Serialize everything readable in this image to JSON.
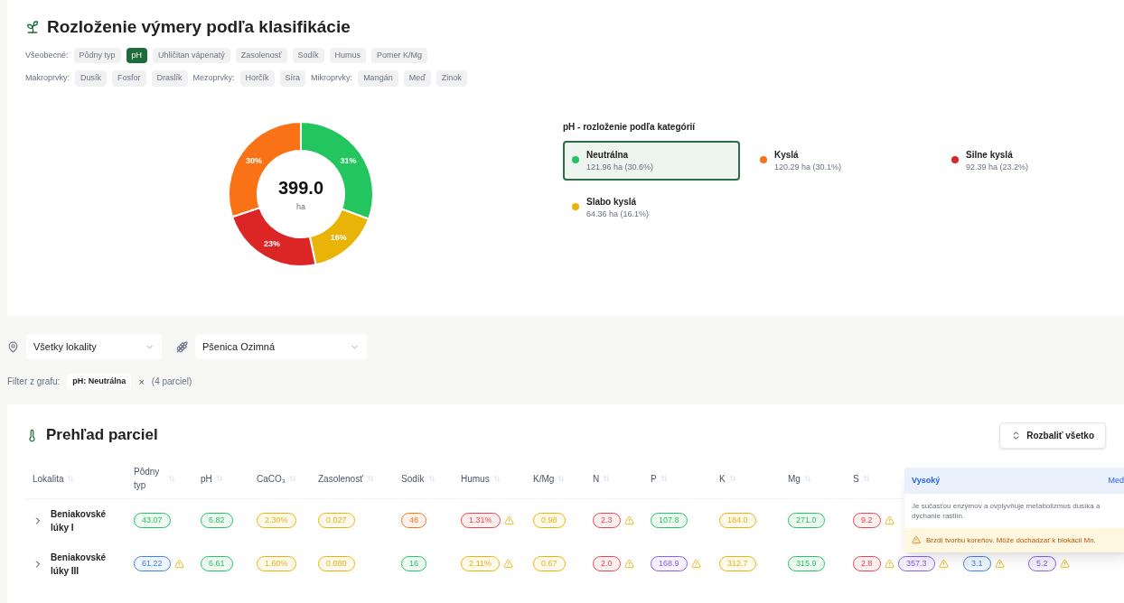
{
  "distribution": {
    "title": "Rozloženie výmery podľa klasifikácie",
    "filter_lines": [
      [
        {
          "label": "Všeobecné:",
          "chips": [
            {
              "label": "Pôdny typ",
              "selected": false
            },
            {
              "label": "pH",
              "selected": true
            },
            {
              "label": "Uhličitan vápenatý",
              "selected": false
            },
            {
              "label": "Zasolenosť",
              "selected": false
            },
            {
              "label": "Sodík",
              "selected": false
            },
            {
              "label": "Humus",
              "selected": false
            },
            {
              "label": "Pomer K/Mg",
              "selected": false
            }
          ]
        }
      ],
      [
        {
          "label": "Makroprvky:",
          "chips": [
            {
              "label": "Dusík",
              "selected": false
            },
            {
              "label": "Fosfor",
              "selected": false
            },
            {
              "label": "Draslík",
              "selected": false
            }
          ]
        },
        {
          "label": "Mezoprvky:",
          "chips": [
            {
              "label": "Horčík",
              "selected": false
            },
            {
              "label": "Síra",
              "selected": false
            }
          ]
        },
        {
          "label": "Mikroprvky:",
          "chips": [
            {
              "label": "Mangán",
              "selected": false
            },
            {
              "label": "Meď",
              "selected": false
            },
            {
              "label": "Zinok",
              "selected": false
            }
          ]
        }
      ]
    ],
    "donut_total": "399.0",
    "donut_unit": "ha",
    "chart_data": {
      "type": "donut",
      "series": [
        {
          "values": [
            30.6,
            16.1,
            23.2,
            30.1
          ]
        }
      ],
      "colors": [
        "#22c55e",
        "#eab308",
        "#dc2626",
        "#f97316"
      ],
      "value_labels": [
        "31%",
        "16%",
        "23%",
        "30%"
      ]
    },
    "legend_title": "pH - rozloženie podľa kategórií",
    "legend": [
      {
        "label": "Neutrálna",
        "detail": "121.96 ha (30.6%)",
        "color": "#22c55e",
        "selected": true
      },
      {
        "label": "Kyslá",
        "detail": "120.29 ha (30.1%)",
        "color": "#f97316",
        "selected": false
      },
      {
        "label": "Silne kyslá",
        "detail": "92.39 ha (23.2%)",
        "color": "#dc2626",
        "selected": false
      },
      {
        "label": "Slabo kyslá",
        "detail": "64.36 ha (16.1%)",
        "color": "#eab308",
        "selected": false
      }
    ]
  },
  "filters": {
    "location": "Všetky lokality",
    "crop": "Pšenica Ozimná",
    "chart_filter_label": "Filter z grafu:",
    "chart_filter_chip": "pH: Neutrálna",
    "chart_filter_remove": "×",
    "chart_filter_count": "(4 parciel)"
  },
  "parcels": {
    "title": "Prehľad parciel",
    "expand_button": "Rozbaliť všetko",
    "columns": [
      "Lokalita",
      "Pôdny typ",
      "pH",
      "CaCO₃",
      "Zasolenosť",
      "Sodík",
      "Humus",
      "K/Mg",
      "N",
      "P",
      "K",
      "Mg",
      "S"
    ],
    "rows": [
      {
        "cells": [
          {
            "kind": "location",
            "value": "Beniakovské lúky I"
          },
          {
            "kind": "badge",
            "value": "43.07",
            "color": "#22c55e"
          },
          {
            "kind": "badge",
            "value": "6.82",
            "color": "#22c55e"
          },
          {
            "kind": "badge",
            "value": "2.30%",
            "color": "#eab308"
          },
          {
            "kind": "badge",
            "value": "0.027",
            "color": "#eab308"
          },
          {
            "kind": "badge",
            "value": "48",
            "color": "#f97316"
          },
          {
            "kind": "flagged",
            "value": "1.31%",
            "color": "#ef4444"
          },
          {
            "kind": "badge",
            "value": "0.98",
            "color": "#eab308"
          },
          {
            "kind": "flagged",
            "value": "2.3",
            "color": "#ef4444"
          },
          {
            "kind": "badge",
            "value": "107.8",
            "color": "#22c55e"
          },
          {
            "kind": "badge",
            "value": "184.0",
            "color": "#eab308"
          },
          {
            "kind": "badge",
            "value": "271.0",
            "color": "#22c55e"
          },
          {
            "kind": "flagged",
            "value": "9.2",
            "color": "#ef4444"
          }
        ]
      },
      {
        "cells": [
          {
            "kind": "location",
            "value": "Beniakovské lúky III"
          },
          {
            "kind": "flagged",
            "value": "61.22",
            "color": "#3b82f6"
          },
          {
            "kind": "badge",
            "value": "6.61",
            "color": "#22c55e"
          },
          {
            "kind": "badge",
            "value": "1.60%",
            "color": "#eab308"
          },
          {
            "kind": "badge",
            "value": "0.080",
            "color": "#eab308"
          },
          {
            "kind": "badge",
            "value": "16",
            "color": "#22c55e"
          },
          {
            "kind": "flagged",
            "value": "2.11%",
            "color": "#eab308"
          },
          {
            "kind": "badge",
            "value": "0.67",
            "color": "#eab308"
          },
          {
            "kind": "flagged",
            "value": "2.0",
            "color": "#ef4444"
          },
          {
            "kind": "flagged",
            "value": "168.9",
            "color": "#8b5cf6"
          },
          {
            "kind": "badge",
            "value": "312.7",
            "color": "#eab308"
          },
          {
            "kind": "badge",
            "value": "315.9",
            "color": "#22c55e"
          },
          {
            "kind": "flagged",
            "value": "2.8",
            "color": "#ef4444"
          },
          {
            "kind": "flagged",
            "value": "357.3",
            "color": "#8b5cf6"
          },
          {
            "kind": "flagged",
            "value": "3.1",
            "color": "#3b82f6"
          },
          {
            "kind": "flagged",
            "value": "5.2",
            "color": "#8b5cf6"
          }
        ]
      }
    ],
    "tooltip": {
      "level": "Vysoký",
      "element": "Med",
      "description": "Je súčasťou enzýmov a ovplyvňuje metabolizmus dusíka a dýchanie rastlín.",
      "warning": "Brzdí tvorbu koreňov. Môže dochádzať k blokácii Mn."
    }
  }
}
